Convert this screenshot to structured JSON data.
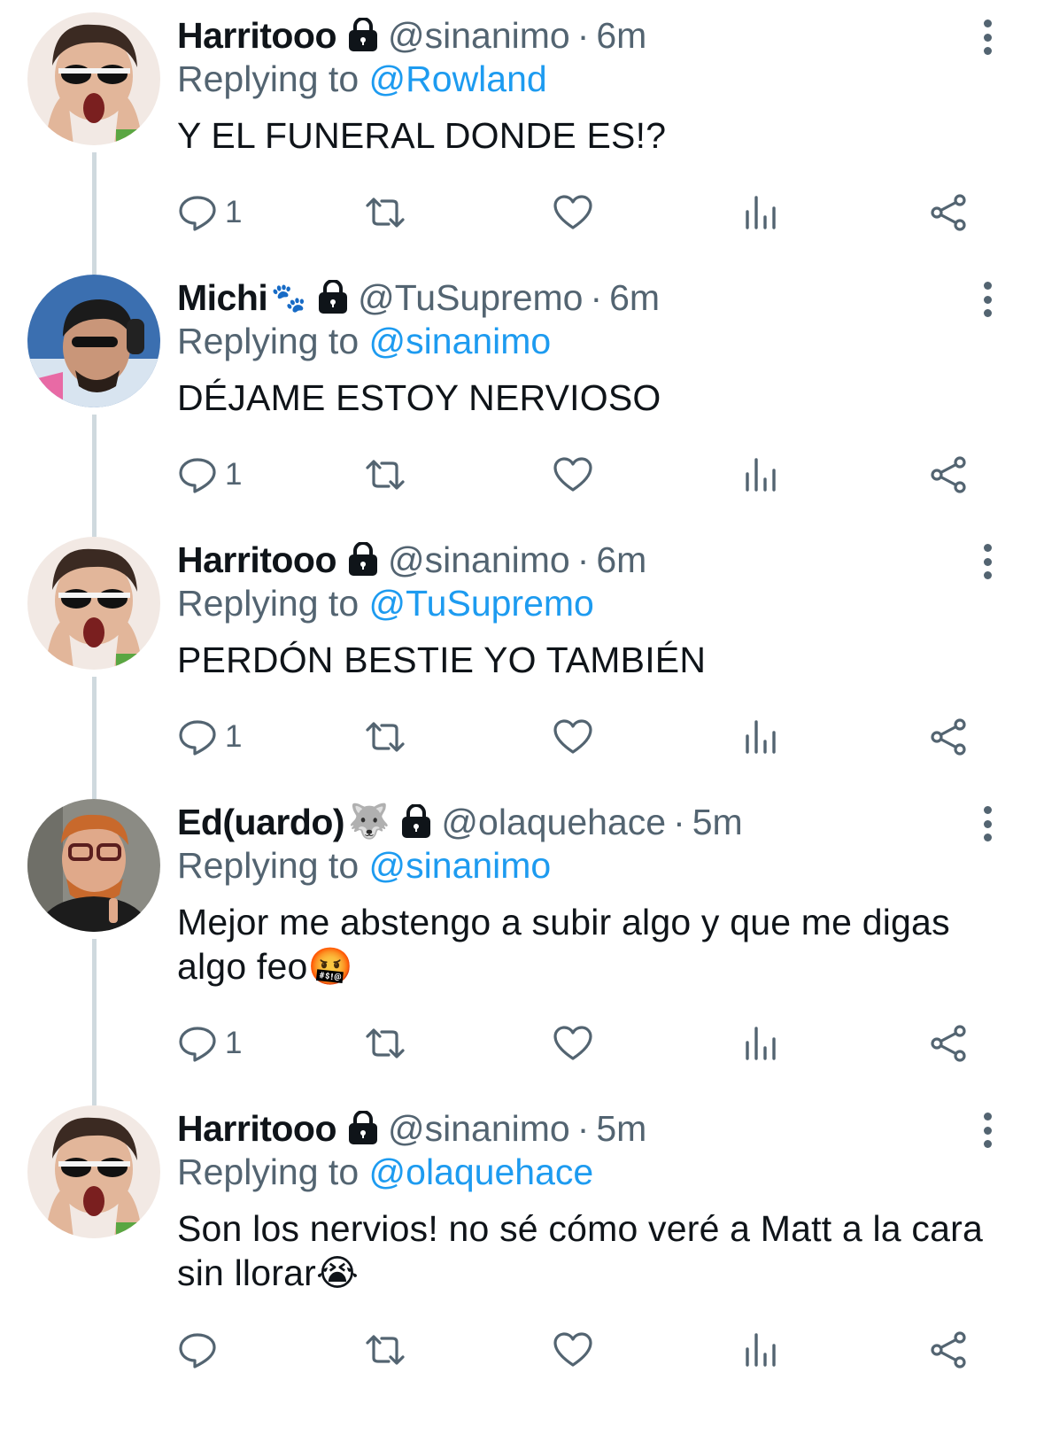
{
  "reply_label": "Replying to",
  "tweets": [
    {
      "avatar": "avatar-harry",
      "display_name": "Harritooo",
      "handle": "@sinanimo",
      "time": "6m",
      "replying_to": "@Rowland",
      "text": "Y EL FUNERAL DONDE ES!?",
      "reply_count": "1"
    },
    {
      "avatar": "avatar-michi",
      "display_name": "Michi",
      "name_emoji": "🐾",
      "handle": "@TuSupremo",
      "time": "6m",
      "replying_to": "@sinanimo",
      "text": "DÉJAME ESTOY NERVIOSO",
      "reply_count": "1"
    },
    {
      "avatar": "avatar-harry",
      "display_name": "Harritooo",
      "handle": "@sinanimo",
      "time": "6m",
      "replying_to": "@TuSupremo",
      "text": "PERDÓN BESTIE YO TAMBIÉN",
      "reply_count": "1"
    },
    {
      "avatar": "avatar-ed",
      "display_name": "Ed(uardo)",
      "name_emoji": "🐺",
      "handle": "@olaquehace",
      "time": "5m",
      "replying_to": "@sinanimo",
      "text": "Mejor me abstengo a subir algo y que me digas algo feo",
      "text_emoji": "🤬",
      "reply_count": "1"
    },
    {
      "avatar": "avatar-harry",
      "display_name": "Harritooo",
      "handle": "@sinanimo",
      "time": "5m",
      "replying_to": "@olaquehace",
      "text": "Son los nervios! no sé cómo veré a Matt a la cara sin llorar",
      "text_emoji": "😭",
      "reply_count": ""
    }
  ],
  "colors": {
    "text": "#0f1419",
    "secondary": "#536471",
    "link": "#1d9bf0",
    "thread_line": "#cfd9de"
  },
  "icons": [
    "lock-icon",
    "more-icon",
    "reply-icon",
    "retweet-icon",
    "like-icon",
    "analytics-icon",
    "share-icon"
  ]
}
